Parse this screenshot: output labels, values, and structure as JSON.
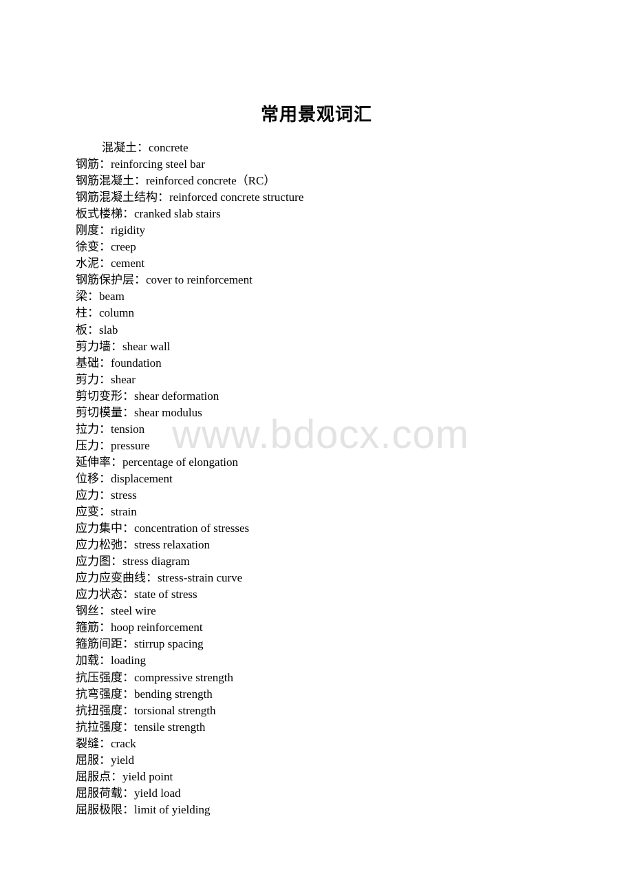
{
  "document": {
    "title": "常用景观词汇",
    "watermark": "www.bdocx.com",
    "entries": [
      "混凝土：concrete",
      "钢筋：reinforcing steel bar",
      "钢筋混凝土：reinforced concrete（RC）",
      "钢筋混凝土结构：reinforced concrete structure",
      "板式楼梯：cranked slab stairs",
      "刚度：rigidity",
      "徐变：creep",
      "水泥：cement",
      "钢筋保护层：cover to reinforcement",
      "梁：beam",
      "柱：column",
      "板：slab",
      "剪力墙：shear wall",
      "基础：foundation",
      "剪力：shear",
      "剪切变形：shear deformation",
      "剪切模量：shear modulus",
      "拉力：tension",
      "压力：pressure",
      "延伸率：percentage of elongation",
      "位移：displacement",
      "应力：stress",
      "应变：strain",
      "应力集中：concentration of stresses",
      "应力松弛：stress relaxation",
      "应力图：stress diagram",
      "应力应变曲线：stress-strain curve",
      "应力状态：state of stress",
      "钢丝：steel wire",
      "箍筋：hoop reinforcement",
      "箍筋间距：stirrup spacing",
      "加载：loading",
      "抗压强度：compressive strength",
      "抗弯强度：bending strength",
      "抗扭强度：torsional strength",
      "抗拉强度：tensile strength",
      "裂缝：crack",
      "屈服：yield",
      "屈服点：yield point",
      "屈服荷载：yield load",
      "屈服极限：limit of yielding"
    ]
  }
}
